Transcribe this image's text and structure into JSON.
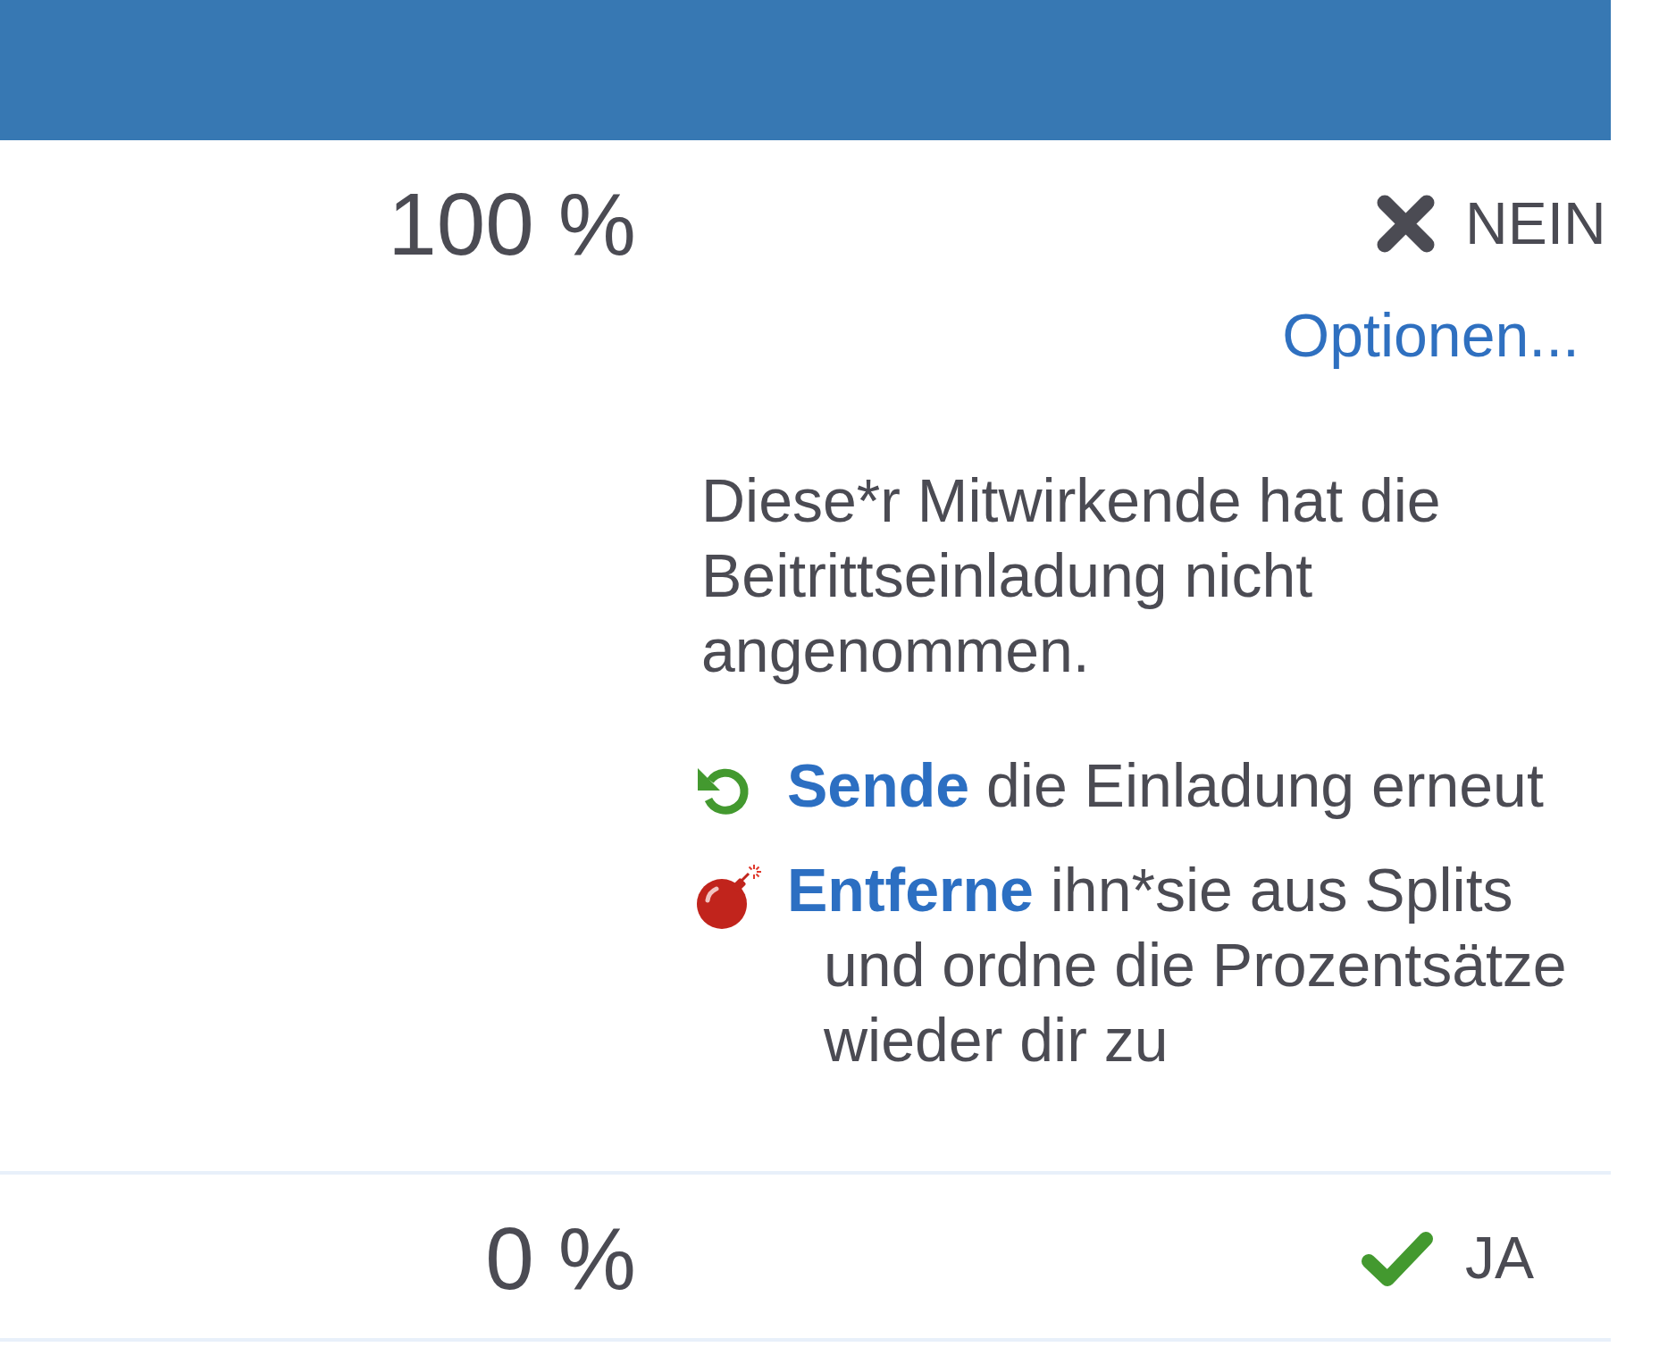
{
  "rows": [
    {
      "percent": "100 %",
      "status": {
        "accepted": false,
        "label": "NEIN"
      },
      "options_link": "Optionen...",
      "message": {
        "text": "Diese*r Mitwirkende hat die Beitrittseinladung nicht angenommen.",
        "actions": [
          {
            "kind": "resend",
            "link": "Sende",
            "text": "die Einladung erneut"
          },
          {
            "kind": "remove",
            "link": "Entferne",
            "text": "ihn*sie aus Splits und ordne die Prozentsätze wieder dir zu"
          }
        ]
      }
    },
    {
      "percent": "0 %",
      "status": {
        "accepted": true,
        "label": "JA"
      }
    }
  ]
}
